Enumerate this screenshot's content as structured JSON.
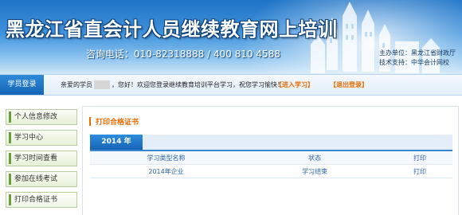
{
  "header": {
    "site_title": "黑龙江省直会计人员继续教育网上培训",
    "hotline": "咨询电话：010-82318888 / 400 810 4588",
    "sponsor": "主办单位：黑龙江省财政厅",
    "tech_support": "技术支持：中华会计网校"
  },
  "statusbar": {
    "login_tab": "学员登录",
    "greeting_prefix": "亲爱的学员",
    "greeting_suffix": "，您好！欢迎您登录继续教育培训平台学习，祝您学习愉快！",
    "enter_study": "【进入学习】",
    "logout": "【退出登录】"
  },
  "sidebar": {
    "items": [
      {
        "label": "个人信息修改"
      },
      {
        "label": "学习中心"
      },
      {
        "label": "学习时间查看"
      },
      {
        "label": "参加在线考试"
      },
      {
        "label": "打印合格证书"
      }
    ]
  },
  "main": {
    "title": "打印合格证书",
    "year_tab": "2014 年",
    "columns": [
      "学习类型名称",
      "状态",
      "打印"
    ],
    "rows": [
      {
        "type": "2014年企业",
        "status": "学习结束",
        "action": "打印"
      }
    ]
  },
  "colors": {
    "brand_blue": "#1f74c6",
    "accent_orange": "#e96b00",
    "sidebar_green": "#6a9e3a",
    "link_blue": "#2a63a8"
  }
}
